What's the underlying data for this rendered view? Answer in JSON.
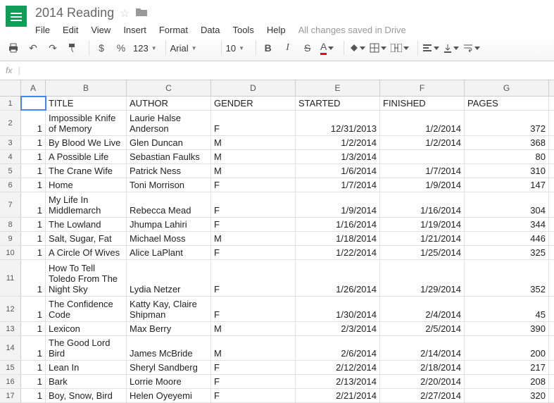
{
  "doc": {
    "title": "2014 Reading",
    "save_status": "All changes saved in Drive"
  },
  "menus": [
    "File",
    "Edit",
    "View",
    "Insert",
    "Format",
    "Data",
    "Tools",
    "Help"
  ],
  "toolbar": {
    "currency": "$",
    "percent": "%",
    "digits": "123",
    "font": "Arial",
    "fontsize": "10"
  },
  "fx": {
    "label": "fx"
  },
  "columns": [
    "A",
    "B",
    "C",
    "D",
    "E",
    "F",
    "G"
  ],
  "headers": {
    "a": "",
    "b": "TITLE",
    "c": "AUTHOR",
    "d": "GENDER",
    "e": "STARTED",
    "f": "FINISHED",
    "g": "PAGES"
  },
  "rows": [
    {
      "n": "1",
      "a": "",
      "b": "TITLE",
      "c": "AUTHOR",
      "d": "GENDER",
      "e": "STARTED",
      "f": "FINISHED",
      "g": "PAGES",
      "header": true
    },
    {
      "n": "2",
      "a": "1",
      "b": "Impossible Knife of Memory",
      "c": "Laurie Halse Anderson",
      "d": "F",
      "e": "12/31/2013",
      "f": "1/2/2014",
      "g": "372"
    },
    {
      "n": "3",
      "a": "1",
      "b": "By Blood We Live",
      "c": "Glen Duncan",
      "d": "M",
      "e": "1/2/2014",
      "f": "1/2/2014",
      "g": "368"
    },
    {
      "n": "4",
      "a": "1",
      "b": "A Possible Life",
      "c": "Sebastian Faulks",
      "d": "M",
      "e": "1/3/2014",
      "f": "",
      "g": "80"
    },
    {
      "n": "5",
      "a": "1",
      "b": "The Crane Wife",
      "c": "Patrick Ness",
      "d": "M",
      "e": "1/6/2014",
      "f": "1/7/2014",
      "g": "310"
    },
    {
      "n": "6",
      "a": "1",
      "b": "Home",
      "c": "Toni Morrison",
      "d": "F",
      "e": "1/7/2014",
      "f": "1/9/2014",
      "g": "147"
    },
    {
      "n": "7",
      "a": "1",
      "b": "My Life In Middlemarch",
      "c": "Rebecca Mead",
      "d": "F",
      "e": "1/9/2014",
      "f": "1/16/2014",
      "g": "304"
    },
    {
      "n": "8",
      "a": "1",
      "b": "The Lowland",
      "c": "Jhumpa Lahiri",
      "d": "F",
      "e": "1/16/2014",
      "f": "1/19/2014",
      "g": "344"
    },
    {
      "n": "9",
      "a": "1",
      "b": "Salt, Sugar, Fat",
      "c": "Michael Moss",
      "d": "M",
      "e": "1/18/2014",
      "f": "1/21/2014",
      "g": "446"
    },
    {
      "n": "10",
      "a": "1",
      "b": "A Circle Of Wives",
      "c": "Alice LaPlant",
      "d": "F",
      "e": "1/22/2014",
      "f": "1/25/2014",
      "g": "325"
    },
    {
      "n": "11",
      "a": "1",
      "b": "How To Tell Toledo From The Night Sky",
      "c": "Lydia Netzer",
      "d": "F",
      "e": "1/26/2014",
      "f": "1/29/2014",
      "g": "352"
    },
    {
      "n": "12",
      "a": "1",
      "b": "The Confidence Code",
      "c": "Katty Kay, Claire Shipman",
      "d": "F",
      "e": "1/30/2014",
      "f": "2/4/2014",
      "g": "45"
    },
    {
      "n": "13",
      "a": "1",
      "b": "Lexicon",
      "c": "Max Berry",
      "d": "M",
      "e": "2/3/2014",
      "f": "2/5/2014",
      "g": "390"
    },
    {
      "n": "14",
      "a": "1",
      "b": "The Good Lord Bird",
      "c": "James McBride",
      "d": "M",
      "e": "2/6/2014",
      "f": "2/14/2014",
      "g": "200"
    },
    {
      "n": "15",
      "a": "1",
      "b": "Lean In",
      "c": "Sheryl Sandberg",
      "d": "F",
      "e": "2/12/2014",
      "f": "2/18/2014",
      "g": "217"
    },
    {
      "n": "16",
      "a": "1",
      "b": "Bark",
      "c": "Lorrie Moore",
      "d": "F",
      "e": "2/13/2014",
      "f": "2/20/2014",
      "g": "208"
    },
    {
      "n": "17",
      "a": "1",
      "b": "Boy, Snow, Bird",
      "c": "Helen Oyeyemi",
      "d": "F",
      "e": "2/21/2014",
      "f": "2/27/2014",
      "g": "320"
    }
  ]
}
